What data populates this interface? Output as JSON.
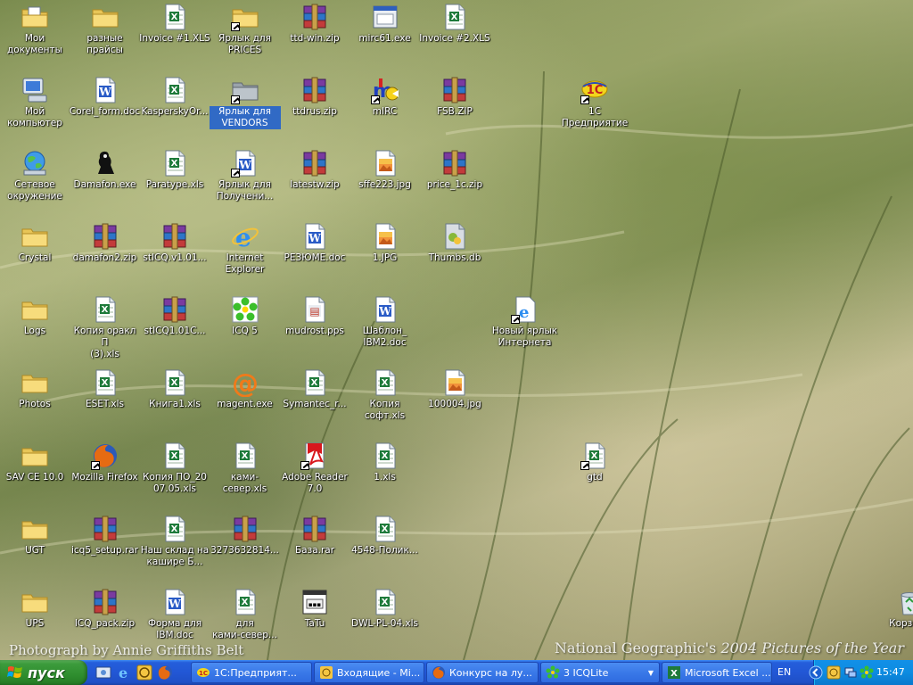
{
  "desktop": {
    "icons": [
      {
        "id": "moi-dokumenty",
        "label": "Мои\nдокументы",
        "type": "mydocs",
        "col": 0,
        "row": 0
      },
      {
        "id": "raznye-praisy",
        "label": "разные\nпрайсы",
        "type": "folder",
        "col": 1,
        "row": 0
      },
      {
        "id": "invoice-1",
        "label": "Invoice #1.XLS",
        "type": "xls",
        "col": 2,
        "row": 0
      },
      {
        "id": "yarlyk-prices",
        "label": "Ярлык для\nPRICES",
        "type": "folder",
        "col": 3,
        "row": 0,
        "shortcut": true
      },
      {
        "id": "ttd-win",
        "label": "ttd-win.zip",
        "type": "rar",
        "col": 4,
        "row": 0
      },
      {
        "id": "mirc61",
        "label": "mirc61.exe",
        "type": "exe",
        "col": 5,
        "row": 0
      },
      {
        "id": "invoice-2",
        "label": "Invoice #2.XLS",
        "type": "xls",
        "col": 6,
        "row": 0
      },
      {
        "id": "moi-kompyuter",
        "label": "Мой\nкомпьютер",
        "type": "computer",
        "col": 0,
        "row": 1
      },
      {
        "id": "corel-form",
        "label": "Corel_form.doc",
        "type": "doc",
        "col": 1,
        "row": 1
      },
      {
        "id": "kaspersky",
        "label": "KasperskyOr...",
        "type": "xls",
        "col": 2,
        "row": 1
      },
      {
        "id": "yarlyk-vendors",
        "label": "Ярлык для\nVENDORS",
        "type": "folder-gray",
        "col": 3,
        "row": 1,
        "shortcut": true,
        "selected": true
      },
      {
        "id": "ttdrus",
        "label": "ttdrus.zip",
        "type": "rar",
        "col": 4,
        "row": 1
      },
      {
        "id": "mirc",
        "label": "mIRC",
        "type": "mirc",
        "col": 5,
        "row": 1,
        "shortcut": true
      },
      {
        "id": "fsb-zip",
        "label": "FSB.ZIP",
        "type": "rar",
        "col": 6,
        "row": 1
      },
      {
        "id": "1c-predpriyatie",
        "label": "1С\nПредприятие",
        "type": "onec",
        "col": 8,
        "row": 1,
        "shortcut": true
      },
      {
        "id": "setevoe",
        "label": "Сетевое\nокружение",
        "type": "network",
        "col": 0,
        "row": 2
      },
      {
        "id": "damafon",
        "label": "Damafon.exe",
        "type": "damafon",
        "col": 1,
        "row": 2
      },
      {
        "id": "paratype",
        "label": "Paratype.xls",
        "type": "xls",
        "col": 2,
        "row": 2
      },
      {
        "id": "yarlyk-polucheni",
        "label": "Ярлык для\nПолучени...",
        "type": "doc",
        "col": 3,
        "row": 2,
        "shortcut": true
      },
      {
        "id": "latestw",
        "label": "latestw.zip",
        "type": "rar",
        "col": 4,
        "row": 2
      },
      {
        "id": "sffe223",
        "label": "sffe223.jpg",
        "type": "jpg",
        "col": 5,
        "row": 2
      },
      {
        "id": "price-1c",
        "label": "price_1c.zip",
        "type": "rar",
        "col": 6,
        "row": 2
      },
      {
        "id": "crystal",
        "label": "Crystal",
        "type": "folder",
        "col": 0,
        "row": 3
      },
      {
        "id": "damafon2",
        "label": "damafon2.zip",
        "type": "rar",
        "col": 1,
        "row": 3
      },
      {
        "id": "sticq-v1",
        "label": "stICQ.v1.01...",
        "type": "rar",
        "col": 2,
        "row": 3
      },
      {
        "id": "internet-explorer",
        "label": "Internet\nExplorer",
        "type": "ie",
        "col": 3,
        "row": 3
      },
      {
        "id": "rezyume",
        "label": "РЕЗЮМЕ.doc",
        "type": "doc",
        "col": 4,
        "row": 3
      },
      {
        "id": "1-jpg",
        "label": "1.JPG",
        "type": "jpg",
        "col": 5,
        "row": 3
      },
      {
        "id": "thumbs-db",
        "label": "Thumbs.db",
        "type": "thumbs",
        "col": 6,
        "row": 3
      },
      {
        "id": "logs",
        "label": "Logs",
        "type": "folder",
        "col": 0,
        "row": 4
      },
      {
        "id": "kopiya-orakl",
        "label": "Копия оракл П\n(3).xls",
        "type": "xls",
        "col": 1,
        "row": 4
      },
      {
        "id": "sticq1-01c",
        "label": "stICQ1.01C...",
        "type": "rar",
        "col": 2,
        "row": 4
      },
      {
        "id": "icq5",
        "label": "ICQ 5",
        "type": "icq",
        "col": 3,
        "row": 4
      },
      {
        "id": "mudrost",
        "label": "mudrost.pps",
        "type": "pps",
        "col": 4,
        "row": 4
      },
      {
        "id": "shablon-ibm2",
        "label": "Шаблон_\nIBM2.doc",
        "type": "doc",
        "col": 5,
        "row": 4
      },
      {
        "id": "novyi-yarlyk",
        "label": "Новый ярлык\nИнтернета",
        "type": "ieshort",
        "col": 7,
        "row": 4,
        "shortcut": true
      },
      {
        "id": "photos",
        "label": "Photos",
        "type": "folder",
        "col": 0,
        "row": 5
      },
      {
        "id": "eset",
        "label": "ESET.xls",
        "type": "xls",
        "col": 1,
        "row": 5
      },
      {
        "id": "kniga1",
        "label": "Книга1.xls",
        "type": "xls",
        "col": 2,
        "row": 5
      },
      {
        "id": "magent",
        "label": "magent.exe",
        "type": "magent",
        "col": 3,
        "row": 5
      },
      {
        "id": "symantec",
        "label": "Symantec_r...",
        "type": "xls",
        "col": 4,
        "row": 5
      },
      {
        "id": "kopiya-soft",
        "label": "Копия\nсофт.xls",
        "type": "xls",
        "col": 5,
        "row": 5
      },
      {
        "id": "100004-jpg",
        "label": "100004.jpg",
        "type": "jpg",
        "col": 6,
        "row": 5
      },
      {
        "id": "sav-ce",
        "label": "SAV CE 10.0",
        "type": "folder",
        "col": 0,
        "row": 6
      },
      {
        "id": "mozilla-firefox",
        "label": "Mozilla Firefox",
        "type": "firefox",
        "col": 1,
        "row": 6,
        "shortcut": true
      },
      {
        "id": "kopiya-po",
        "label": "Копия ПО_20\n07.05.xls",
        "type": "xls",
        "col": 2,
        "row": 6
      },
      {
        "id": "kami-sever",
        "label": "ками-север.xls",
        "type": "xls",
        "col": 3,
        "row": 6
      },
      {
        "id": "adobe-reader",
        "label": "Adobe Reader\n7.0",
        "type": "acrobat",
        "col": 4,
        "row": 6,
        "shortcut": true
      },
      {
        "id": "1-xls",
        "label": "1.xls",
        "type": "xls",
        "col": 5,
        "row": 6
      },
      {
        "id": "gtd",
        "label": "gtd",
        "type": "xls",
        "col": 8,
        "row": 6,
        "shortcut": true
      },
      {
        "id": "ugt",
        "label": "UGT",
        "type": "folder",
        "col": 0,
        "row": 7
      },
      {
        "id": "icq5-setup",
        "label": "icq5_setup.rar",
        "type": "rar",
        "col": 1,
        "row": 7
      },
      {
        "id": "nash-sklad",
        "label": "Наш склад на\nкашире Б...",
        "type": "xls",
        "col": 2,
        "row": 7
      },
      {
        "id": "3273632814",
        "label": "3273632814...",
        "type": "rar",
        "col": 3,
        "row": 7
      },
      {
        "id": "baza-rar",
        "label": "База.rar",
        "type": "rar",
        "col": 4,
        "row": 7
      },
      {
        "id": "4548-polik",
        "label": "4548-Полик...",
        "type": "xls",
        "col": 5,
        "row": 7
      },
      {
        "id": "ups",
        "label": "UPS",
        "type": "folder",
        "col": 0,
        "row": 8
      },
      {
        "id": "icq-pack",
        "label": "ICQ_pack.zip",
        "type": "rar",
        "col": 1,
        "row": 8
      },
      {
        "id": "forma-ibm",
        "label": "Форма для\nIBM.doc",
        "type": "doc",
        "col": 2,
        "row": 8
      },
      {
        "id": "dlya-kami",
        "label": "для\nками-север...",
        "type": "xls",
        "col": 3,
        "row": 8
      },
      {
        "id": "tatu",
        "label": "TaTu",
        "type": "tatu",
        "col": 4,
        "row": 8
      },
      {
        "id": "dwl-pl-04",
        "label": "DWL-PL-04.xls",
        "type": "xls",
        "col": 5,
        "row": 8
      },
      {
        "id": "korzina",
        "label": "Корзина",
        "type": "recycle",
        "col": 12.5,
        "row": 8
      }
    ],
    "watermark_left": "Photograph by Annie Griffiths Belt",
    "watermark_right_a": "National Geographic's",
    "watermark_right_b": "2004 Pictures of the Year"
  },
  "taskbar": {
    "start_label": "пуск",
    "tasks": [
      {
        "label": "1С:Предприят...",
        "icon": "onec"
      },
      {
        "label": "Входящие - Mi...",
        "icon": "outlook"
      },
      {
        "label": "Конкурс на лу...",
        "icon": "firefox"
      },
      {
        "label": "3 ICQLite",
        "icon": "icq"
      },
      {
        "label": "Microsoft Excel ...",
        "icon": "excel"
      }
    ],
    "language": "EN",
    "clock": "15:47"
  },
  "colors": {
    "selection": "#316ac5",
    "taskbar": "#245edb",
    "start": "#3c9b3c",
    "tray": "#0d8ce1"
  }
}
